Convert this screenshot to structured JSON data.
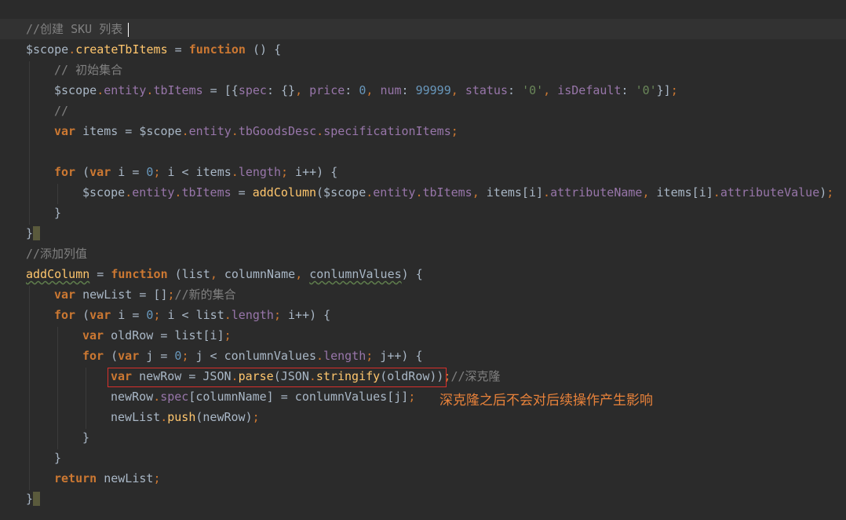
{
  "editor": {
    "lines": [
      "//创建 SKU 列表",
      "$scope.createTbItems = function () {",
      "// 初始集合",
      "$scope.entity.tbItems = [{spec: {}, price: 0, num: 99999, status: '0', isDefault: '0'}];",
      "//",
      "var items = $scope.entity.tbGoodsDesc.specificationItems;",
      "",
      "for (var i = 0; i < items.length; i++) {",
      "$scope.entity.tbItems = addColumn($scope.entity.tbItems, items[i].attributeName, items[i].attributeValue);",
      "}",
      "}",
      "//添加列值",
      "addColumn = function (list, columnName, conlumnValues) {",
      "var newList = [];//新的集合",
      "for (var i = 0; i < list.length; i++) {",
      "var oldRow = list[i];",
      "for (var j = 0; j < conlumnValues.length; j++) {",
      "var newRow = JSON.parse(JSON.stringify(oldRow));//深克隆",
      "newRow.spec[columnName] = conlumnValues[j];",
      "newList.push(newRow);",
      "}",
      "}",
      "return newList;",
      "}"
    ],
    "annotation": "深克隆之后不会对后续操作产生影响",
    "colors": {
      "background": "#2b2b2b",
      "current_line": "#323232",
      "keyword": "#cc7832",
      "function": "#ffc66d",
      "property": "#9876aa",
      "number": "#6897bb",
      "string": "#6a8759",
      "comment": "#808080",
      "plain": "#a9b7c6",
      "highlight_box": "#d9302c",
      "annotation": "#e8823a"
    }
  }
}
